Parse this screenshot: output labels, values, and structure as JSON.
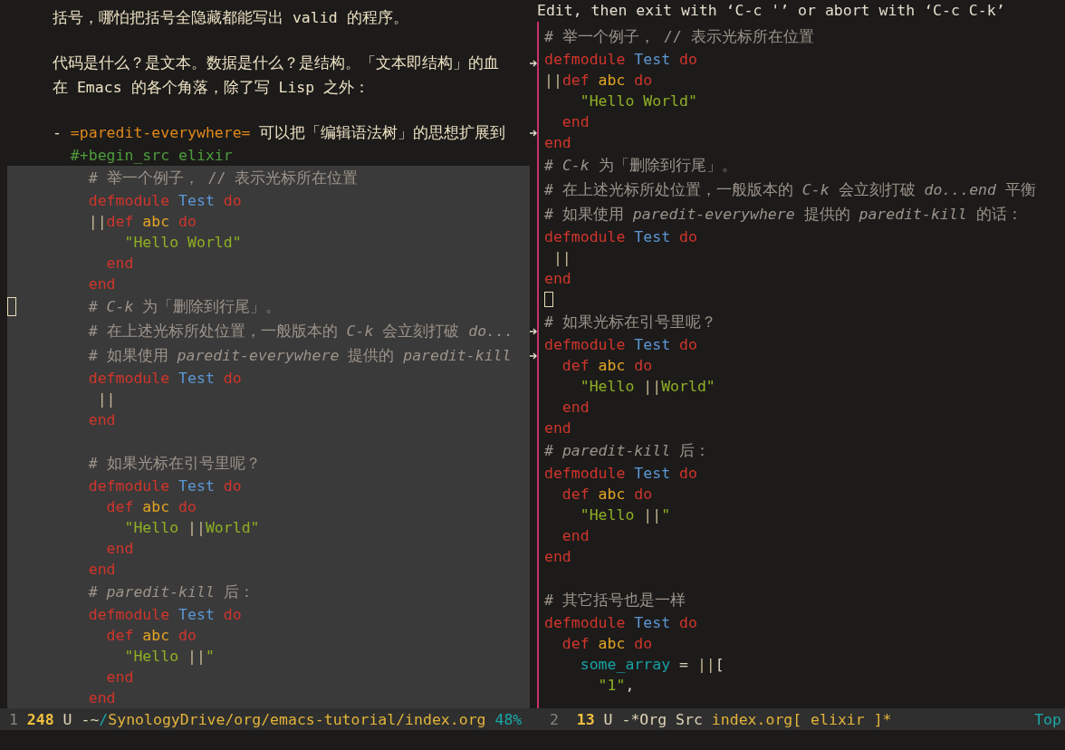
{
  "windows": [
    {
      "kind": "org",
      "lines": [
        {
          "kind": "text",
          "tokens": [
            {
              "kind": "prose",
              "text": "括号，哪怕把括号全隐藏都能写出 valid 的程序。"
            }
          ]
        },
        {
          "kind": "blank"
        },
        {
          "kind": "text",
          "tokens": [
            {
              "kind": "prose",
              "text": "代码是什么？是文本。数据是什么？是结构。「文本即结构」的血"
            },
            {
              "kind": "continuation"
            }
          ]
        },
        {
          "kind": "text",
          "tokens": [
            {
              "kind": "prose",
              "text": "在 Emacs 的各个角落，除了写 Lisp 之外："
            }
          ]
        },
        {
          "kind": "blank"
        },
        {
          "kind": "text",
          "tokens": [
            {
              "kind": "bullet",
              "text": "-"
            },
            {
              "kind": "verbatim",
              "text": " =paredit-everywhere="
            },
            {
              "kind": "prose",
              "text": " 可以把「编辑语法树」的思想扩展到"
            },
            {
              "kind": "continuation"
            }
          ]
        },
        {
          "kind": "text",
          "tokens": [
            {
              "kind": "meta",
              "text": "  #+begin_src elixir"
            }
          ]
        }
      ],
      "src_block": {
        "lines": [
          {
            "kind": "text",
            "tokens": [
              {
                "kind": "comment",
                "text": "    # 举一个例子， // 表示光标所在位置"
              }
            ]
          },
          {
            "kind": "text",
            "tokens": [
              {
                "kind": "kw",
                "text": "    defmodule"
              },
              {
                "kind": "type",
                "text": " Test"
              },
              {
                "kind": "kw",
                "text": " do"
              }
            ]
          },
          {
            "kind": "text",
            "tokens": [
              {
                "kind": "point",
                "text": "    ||"
              },
              {
                "kind": "kw",
                "text": "def"
              },
              {
                "kind": "fn",
                "text": " abc"
              },
              {
                "kind": "kw",
                "text": " do"
              }
            ]
          },
          {
            "kind": "text",
            "tokens": [
              {
                "kind": "str",
                "text": "        \"Hello World\""
              }
            ]
          },
          {
            "kind": "text",
            "tokens": [
              {
                "kind": "kw",
                "text": "      end"
              }
            ]
          },
          {
            "kind": "text",
            "tokens": [
              {
                "kind": "kw",
                "text": "    end"
              }
            ]
          },
          {
            "kind": "text",
            "tokens": [
              {
                "kind": "cursor"
              },
              {
                "kind": "comment",
                "text": "    # *C-k* 为「删除到行尾」。"
              }
            ]
          },
          {
            "kind": "text",
            "tokens": [
              {
                "kind": "comment",
                "text": "    # 在上述光标所处位置，一般版本的 *C-k* 会立刻打破 *do...*"
              },
              {
                "kind": "continuation"
              }
            ]
          },
          {
            "kind": "text",
            "tokens": [
              {
                "kind": "comment",
                "text": "    # 如果使用 *paredit-everywhere* 提供的 *paredit-kill*"
              },
              {
                "kind": "continuation"
              }
            ]
          },
          {
            "kind": "text",
            "tokens": [
              {
                "kind": "kw",
                "text": "    defmodule"
              },
              {
                "kind": "type",
                "text": " Test"
              },
              {
                "kind": "kw",
                "text": " do"
              }
            ]
          },
          {
            "kind": "text",
            "tokens": [
              {
                "kind": "point",
                "text": "     ||"
              }
            ]
          },
          {
            "kind": "text",
            "tokens": [
              {
                "kind": "kw",
                "text": "    end"
              }
            ]
          },
          {
            "kind": "blank"
          },
          {
            "kind": "text",
            "tokens": [
              {
                "kind": "comment",
                "text": "    # 如果光标在引号里呢？"
              }
            ]
          },
          {
            "kind": "text",
            "tokens": [
              {
                "kind": "kw",
                "text": "    defmodule"
              },
              {
                "kind": "type",
                "text": " Test"
              },
              {
                "kind": "kw",
                "text": " do"
              }
            ]
          },
          {
            "kind": "text",
            "tokens": [
              {
                "kind": "kw",
                "text": "      def"
              },
              {
                "kind": "fn",
                "text": " abc"
              },
              {
                "kind": "kw",
                "text": " do"
              }
            ]
          },
          {
            "kind": "text",
            "tokens": [
              {
                "kind": "str",
                "text": "        \"Hello "
              },
              {
                "kind": "point",
                "text": "||"
              },
              {
                "kind": "str",
                "text": "World\""
              }
            ]
          },
          {
            "kind": "text",
            "tokens": [
              {
                "kind": "kw",
                "text": "      end"
              }
            ]
          },
          {
            "kind": "text",
            "tokens": [
              {
                "kind": "kw",
                "text": "    end"
              }
            ]
          },
          {
            "kind": "text",
            "tokens": [
              {
                "kind": "comment",
                "text": "    # *paredit-kill* 后："
              }
            ]
          },
          {
            "kind": "text",
            "tokens": [
              {
                "kind": "kw",
                "text": "    defmodule"
              },
              {
                "kind": "type",
                "text": " Test"
              },
              {
                "kind": "kw",
                "text": " do"
              }
            ]
          },
          {
            "kind": "text",
            "tokens": [
              {
                "kind": "kw",
                "text": "      def"
              },
              {
                "kind": "fn",
                "text": " abc"
              },
              {
                "kind": "kw",
                "text": " do"
              }
            ]
          },
          {
            "kind": "text",
            "tokens": [
              {
                "kind": "str",
                "text": "        \"Hello "
              },
              {
                "kind": "point",
                "text": "||"
              },
              {
                "kind": "str",
                "text": "\""
              }
            ]
          },
          {
            "kind": "text",
            "tokens": [
              {
                "kind": "kw",
                "text": "      end"
              }
            ]
          },
          {
            "kind": "text",
            "tokens": [
              {
                "kind": "kw",
                "text": "    end"
              }
            ]
          }
        ]
      },
      "mode_line": {
        "segments": [
          {
            "kind": "winnum",
            "text": "1"
          },
          {
            "kind": "line",
            "text": " 248"
          },
          {
            "kind": "plain",
            "text": " U -~"
          },
          {
            "kind": "accent",
            "text": "/"
          },
          {
            "kind": "buffer",
            "text": "SynologyDrive/org/emacs-tutorial/index.org"
          },
          {
            "kind": "accent",
            "text": " 48%"
          }
        ]
      }
    },
    {
      "kind": "edit",
      "header": "Edit, then exit with ‘C-c '’ or abort with ‘C-c C-k’",
      "lines": [
        {
          "kind": "text",
          "tokens": [
            {
              "kind": "comment",
              "text": "# 举一个例子， // 表示光标所在位置"
            }
          ]
        },
        {
          "kind": "text",
          "tokens": [
            {
              "kind": "kw",
              "text": "defmodule"
            },
            {
              "kind": "type",
              "text": " Test"
            },
            {
              "kind": "kw",
              "text": " do"
            }
          ]
        },
        {
          "kind": "text",
          "tokens": [
            {
              "kind": "point",
              "text": "||"
            },
            {
              "kind": "kw",
              "text": "def"
            },
            {
              "kind": "fn",
              "text": " abc"
            },
            {
              "kind": "kw",
              "text": " do"
            }
          ]
        },
        {
          "kind": "text",
          "tokens": [
            {
              "kind": "str",
              "text": "    \"Hello World\""
            }
          ]
        },
        {
          "kind": "text",
          "tokens": [
            {
              "kind": "kw",
              "text": "  end"
            }
          ]
        },
        {
          "kind": "text",
          "tokens": [
            {
              "kind": "kw",
              "text": "end"
            }
          ]
        },
        {
          "kind": "text",
          "tokens": [
            {
              "kind": "comment",
              "text": "# *C-k* 为「删除到行尾」。"
            }
          ]
        },
        {
          "kind": "text",
          "tokens": [
            {
              "kind": "comment",
              "text": "# 在上述光标所处位置，一般版本的 *C-k* 会立刻打破 *do...end* 平衡"
            }
          ]
        },
        {
          "kind": "text",
          "tokens": [
            {
              "kind": "comment",
              "text": "# 如果使用 *paredit-everywhere* 提供的 *paredit-kill* 的话："
            }
          ]
        },
        {
          "kind": "text",
          "tokens": [
            {
              "kind": "kw",
              "text": "defmodule"
            },
            {
              "kind": "type",
              "text": " Test"
            },
            {
              "kind": "kw",
              "text": " do"
            }
          ]
        },
        {
          "kind": "text",
          "tokens": [
            {
              "kind": "point",
              "text": " ||"
            }
          ]
        },
        {
          "kind": "text",
          "tokens": [
            {
              "kind": "kw",
              "text": "end"
            }
          ]
        },
        {
          "kind": "text",
          "tokens": [
            {
              "kind": "cursor"
            }
          ]
        },
        {
          "kind": "text",
          "tokens": [
            {
              "kind": "comment",
              "text": "# 如果光标在引号里呢？"
            }
          ]
        },
        {
          "kind": "text",
          "tokens": [
            {
              "kind": "kw",
              "text": "defmodule"
            },
            {
              "kind": "type",
              "text": " Test"
            },
            {
              "kind": "kw",
              "text": " do"
            }
          ]
        },
        {
          "kind": "text",
          "tokens": [
            {
              "kind": "kw",
              "text": "  def"
            },
            {
              "kind": "fn",
              "text": " abc"
            },
            {
              "kind": "kw",
              "text": " do"
            }
          ]
        },
        {
          "kind": "text",
          "tokens": [
            {
              "kind": "str",
              "text": "    \"Hello "
            },
            {
              "kind": "point",
              "text": "||"
            },
            {
              "kind": "str",
              "text": "World\""
            }
          ]
        },
        {
          "kind": "text",
          "tokens": [
            {
              "kind": "kw",
              "text": "  end"
            }
          ]
        },
        {
          "kind": "text",
          "tokens": [
            {
              "kind": "kw",
              "text": "end"
            }
          ]
        },
        {
          "kind": "text",
          "tokens": [
            {
              "kind": "comment",
              "text": "# *paredit-kill* 后："
            }
          ]
        },
        {
          "kind": "text",
          "tokens": [
            {
              "kind": "kw",
              "text": "defmodule"
            },
            {
              "kind": "type",
              "text": " Test"
            },
            {
              "kind": "kw",
              "text": " do"
            }
          ]
        },
        {
          "kind": "text",
          "tokens": [
            {
              "kind": "kw",
              "text": "  def"
            },
            {
              "kind": "fn",
              "text": " abc"
            },
            {
              "kind": "kw",
              "text": " do"
            }
          ]
        },
        {
          "kind": "text",
          "tokens": [
            {
              "kind": "str",
              "text": "    \"Hello "
            },
            {
              "kind": "point",
              "text": "||"
            },
            {
              "kind": "str",
              "text": "\""
            }
          ]
        },
        {
          "kind": "text",
          "tokens": [
            {
              "kind": "kw",
              "text": "  end"
            }
          ]
        },
        {
          "kind": "text",
          "tokens": [
            {
              "kind": "kw",
              "text": "end"
            }
          ]
        },
        {
          "kind": "blank"
        },
        {
          "kind": "text",
          "tokens": [
            {
              "kind": "comment",
              "text": "# 其它括号也是一样"
            }
          ]
        },
        {
          "kind": "text",
          "tokens": [
            {
              "kind": "kw",
              "text": "defmodule"
            },
            {
              "kind": "type",
              "text": " Test"
            },
            {
              "kind": "kw",
              "text": " do"
            }
          ]
        },
        {
          "kind": "text",
          "tokens": [
            {
              "kind": "kw",
              "text": "  def"
            },
            {
              "kind": "fn",
              "text": " abc"
            },
            {
              "kind": "kw",
              "text": " do"
            }
          ]
        },
        {
          "kind": "text",
          "tokens": [
            {
              "kind": "var",
              "text": "    some_array"
            },
            {
              "kind": "plain",
              "text": " = "
            },
            {
              "kind": "point",
              "text": "||"
            },
            {
              "kind": "plain",
              "text": "["
            }
          ]
        },
        {
          "kind": "text",
          "tokens": [
            {
              "kind": "str",
              "text": "      \"1\""
            },
            {
              "kind": "plain",
              "text": ","
            }
          ]
        }
      ],
      "mode_line": {
        "segments": [
          {
            "kind": "winnum",
            "text": "2"
          },
          {
            "kind": "line",
            "text": "  13"
          },
          {
            "kind": "plain",
            "text": " U -*Org Src"
          },
          {
            "kind": "buffer",
            "text": " index.org[ elixir ]*"
          },
          {
            "kind": "right",
            "text": "Top"
          }
        ]
      }
    }
  ]
}
